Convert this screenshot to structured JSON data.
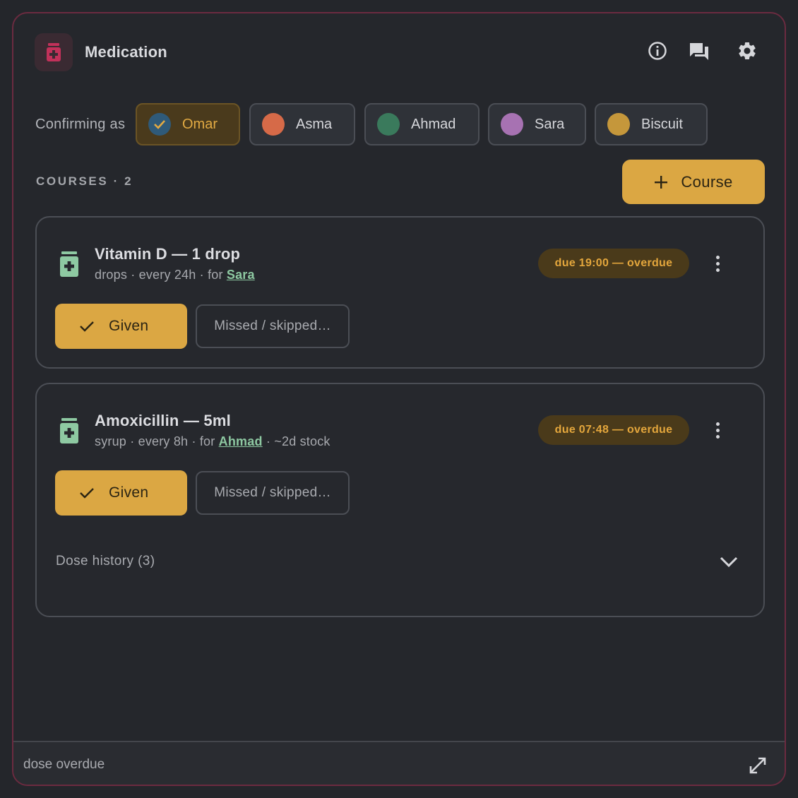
{
  "header": {
    "title": "Medication",
    "icons": [
      "pill-bottle-icon",
      "info-icon",
      "chat-icon",
      "gear-icon"
    ],
    "accent": "#c2315a"
  },
  "confirm": {
    "label": "Confirming as",
    "people": [
      {
        "name": "Omar",
        "color": "#2f5a79",
        "selected": true
      },
      {
        "name": "Asma",
        "color": "#d66a48",
        "selected": false
      },
      {
        "name": "Ahmad",
        "color": "#3a7a5c",
        "selected": false
      },
      {
        "name": "Sara",
        "color": "#a772b2",
        "selected": false
      },
      {
        "name": "Biscuit",
        "color": "#c5973b",
        "selected": false
      }
    ]
  },
  "courses": {
    "label": "COURSES · 2",
    "add_label": "Course",
    "items": [
      {
        "title": "Vitamin D — 1 drop",
        "sub_prefix": "drops · every 24h · for ",
        "person": "Sara",
        "sub_suffix": "",
        "due": "due 19:00 — overdue",
        "given_label": "Given",
        "missed_label": "Missed / skipped…"
      },
      {
        "title": "Amoxicillin — 5ml",
        "sub_prefix": "syrup · every 8h · for ",
        "person": "Ahmad",
        "sub_suffix": " · ~2d stock",
        "due": "due 07:48 — overdue",
        "given_label": "Given",
        "missed_label": "Missed / skipped…",
        "history_label": "Dose history (3)"
      }
    ]
  },
  "colors": {
    "primary": "#dba743",
    "medication_green": "#8ec9a2",
    "border": "#6b2b40"
  },
  "footer": {
    "status": "dose overdue"
  }
}
